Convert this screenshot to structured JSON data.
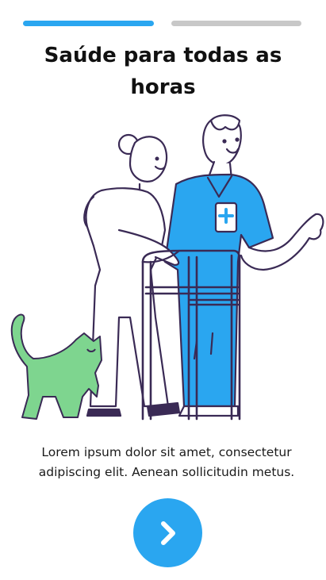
{
  "onboarding": {
    "progress": {
      "total_steps": 2,
      "current_step": 1
    },
    "title": "Saúde para todas as horas",
    "description": "Lorem ipsum dolor sit amet, consectetur adipiscing elit. Aenean sollicitudin metus.",
    "next_button": {
      "icon": "chevron-right-icon"
    },
    "illustration": "nurse-helping-elderly-woman-with-walker-and-cat"
  },
  "colors": {
    "accent": "#2aa6f0",
    "inactive": "#c8c8c8",
    "scrubs": "#2aa6f0",
    "cat": "#7ed58f",
    "outline": "#3a2a55"
  }
}
